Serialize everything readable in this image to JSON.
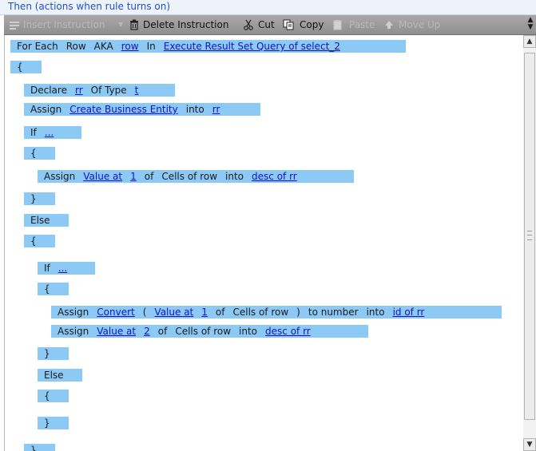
{
  "header": {
    "title": "Then  (actions when rule turns on)"
  },
  "toolbar": {
    "insert": "Insert Instruction",
    "delete": "Delete Instruction",
    "cut": "Cut",
    "copy": "Copy",
    "paste": "Paste",
    "move_up": "Move Up"
  },
  "rows": [
    {
      "parts": [
        {
          "t": "For Each"
        },
        {
          "t": "Row"
        },
        {
          "t": "AKA"
        },
        {
          "l": "row"
        },
        {
          "t": "In"
        },
        {
          "l": "Execute Result Set Query of select_2"
        }
      ]
    },
    {
      "parts": [
        {
          "t": "{"
        }
      ]
    },
    {
      "parts": [
        {
          "t": "Declare"
        },
        {
          "l": "rr"
        },
        {
          "t": "Of Type"
        },
        {
          "l": "t"
        }
      ]
    },
    {
      "parts": [
        {
          "t": "Assign"
        },
        {
          "l": "Create Business Entity"
        },
        {
          "t": "into"
        },
        {
          "l": "rr"
        }
      ]
    },
    {
      "parts": [
        {
          "t": "If"
        },
        {
          "l": "..."
        }
      ]
    },
    {
      "parts": [
        {
          "t": "{"
        }
      ]
    },
    {
      "parts": [
        {
          "t": "Assign"
        },
        {
          "l": "Value at"
        },
        {
          "l": "1"
        },
        {
          "t": "of"
        },
        {
          "t": "Cells of row"
        },
        {
          "t": "into"
        },
        {
          "l": "desc of rr"
        }
      ]
    },
    {
      "parts": [
        {
          "t": "}"
        }
      ]
    },
    {
      "parts": [
        {
          "t": "Else"
        }
      ]
    },
    {
      "parts": [
        {
          "t": "{"
        }
      ]
    },
    {
      "parts": [
        {
          "t": "If"
        },
        {
          "l": "..."
        }
      ]
    },
    {
      "parts": [
        {
          "t": "{"
        }
      ]
    },
    {
      "parts": [
        {
          "t": "Assign"
        },
        {
          "l": "Convert"
        },
        {
          "t": "("
        },
        {
          "l": "Value at"
        },
        {
          "l": "1"
        },
        {
          "t": "of"
        },
        {
          "t": "Cells of row"
        },
        {
          "t": ")"
        },
        {
          "t": "to number"
        },
        {
          "t": "into"
        },
        {
          "l": "id of rr"
        }
      ]
    },
    {
      "parts": [
        {
          "t": "Assign"
        },
        {
          "l": "Value at"
        },
        {
          "l": "2"
        },
        {
          "t": "of"
        },
        {
          "t": "Cells of row"
        },
        {
          "t": "into"
        },
        {
          "l": "desc of rr"
        }
      ]
    },
    {
      "parts": [
        {
          "t": "}"
        }
      ]
    },
    {
      "parts": [
        {
          "t": "Else"
        }
      ]
    },
    {
      "parts": [
        {
          "t": "{"
        }
      ]
    },
    {
      "parts": [
        {
          "t": "}"
        }
      ]
    },
    {
      "parts": [
        {
          "t": "}"
        }
      ]
    }
  ]
}
